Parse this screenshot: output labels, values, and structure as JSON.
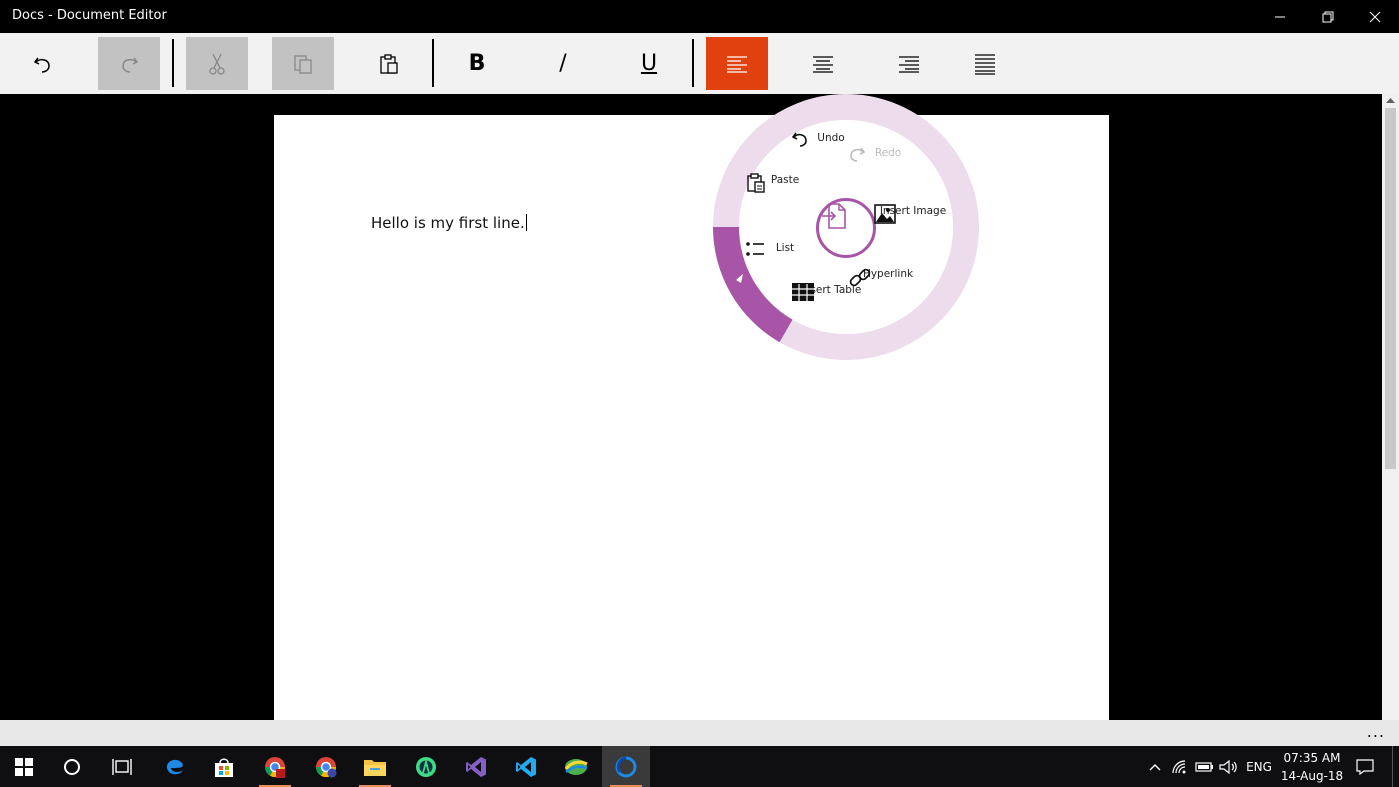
{
  "window": {
    "title": "Docs - Document Editor",
    "controls": [
      "minimize",
      "restore",
      "close"
    ]
  },
  "toolbar": {
    "buttons": [
      {
        "name": "undo",
        "state": "enabled"
      },
      {
        "name": "redo",
        "state": "disabled"
      },
      {
        "name": "cut",
        "state": "disabled"
      },
      {
        "name": "copy",
        "state": "disabled"
      },
      {
        "name": "paste",
        "state": "enabled"
      },
      {
        "name": "bold",
        "label": "B",
        "state": "enabled"
      },
      {
        "name": "italic",
        "label": "/",
        "state": "enabled"
      },
      {
        "name": "underline",
        "label": "U",
        "state": "enabled"
      },
      {
        "name": "align-left",
        "state": "active"
      },
      {
        "name": "align-center",
        "state": "enabled"
      },
      {
        "name": "align-right",
        "state": "enabled"
      },
      {
        "name": "justify",
        "state": "enabled"
      }
    ],
    "bold_label": "B",
    "italic_label": "/",
    "underline_label": "U",
    "active_color": "#e0410e"
  },
  "document": {
    "text": "Hello is my first line."
  },
  "radial_menu": {
    "accent": "#a855a8",
    "ring_color": "#ecdcec",
    "items": {
      "undo": "Undo",
      "redo": "Redo",
      "paste": "Paste",
      "insert_image": "Insert Image",
      "list": "List",
      "hyperlink": "Hyperlink",
      "insert_table": "Insert Table"
    }
  },
  "appbar": {
    "more": "..."
  },
  "taskbar": {
    "language": "ENG",
    "time": "07:35 AM",
    "date": "14-Aug-18"
  }
}
